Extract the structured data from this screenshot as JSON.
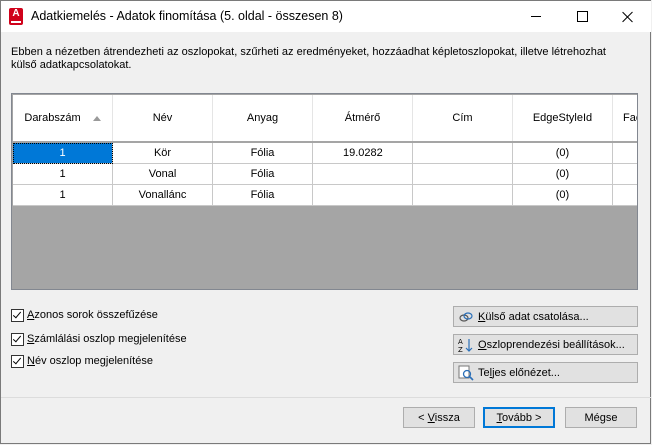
{
  "window": {
    "title": "Adatkiemelés - Adatok finomítása (5. oldal - összesen 8)"
  },
  "description": "Ebben a nézetben átrendezheti az oszlopokat, szűrheti az eredményeket, hozzáadhat képletoszlopokat, illetve létrehozhat külső adatkapcsolatokat.",
  "grid": {
    "columns": [
      "Darabszám",
      "Név",
      "Anyag",
      "Átmérő",
      "Cím",
      "EdgeStyleId",
      "Fac"
    ],
    "rows": [
      [
        "1",
        "Kör",
        "Fólia",
        "19.0282",
        "",
        "(0)",
        ""
      ],
      [
        "1",
        "Vonal",
        "Fólia",
        "",
        "",
        "(0)",
        ""
      ],
      [
        "1",
        "Vonallánc",
        "Fólia",
        "",
        "",
        "(0)",
        ""
      ]
    ]
  },
  "options": {
    "combine_rows_pre": "",
    "combine_rows_ul": "A",
    "combine_rows_post": "zonos sorok összefűzése",
    "show_count_pre": "",
    "show_count_ul": "S",
    "show_count_post": "zámlálási oszlop megjelenítése",
    "show_name_pre": "",
    "show_name_ul": "N",
    "show_name_post": "év oszlop megjelenítése"
  },
  "side_buttons": {
    "link_pre": "",
    "link_ul": "K",
    "link_post": "ülső adat csatolása...",
    "sort_pre": "",
    "sort_ul": "O",
    "sort_post": "szloprendezési beállítások...",
    "preview_pre": "Te",
    "preview_ul": "l",
    "preview_post": "jes előnézet..."
  },
  "nav_buttons": {
    "back_pre": "< ",
    "back_ul": "V",
    "back_post": "issza",
    "next_pre": "",
    "next_ul": "T",
    "next_post": "ovább >",
    "cancel": "Mégse"
  }
}
